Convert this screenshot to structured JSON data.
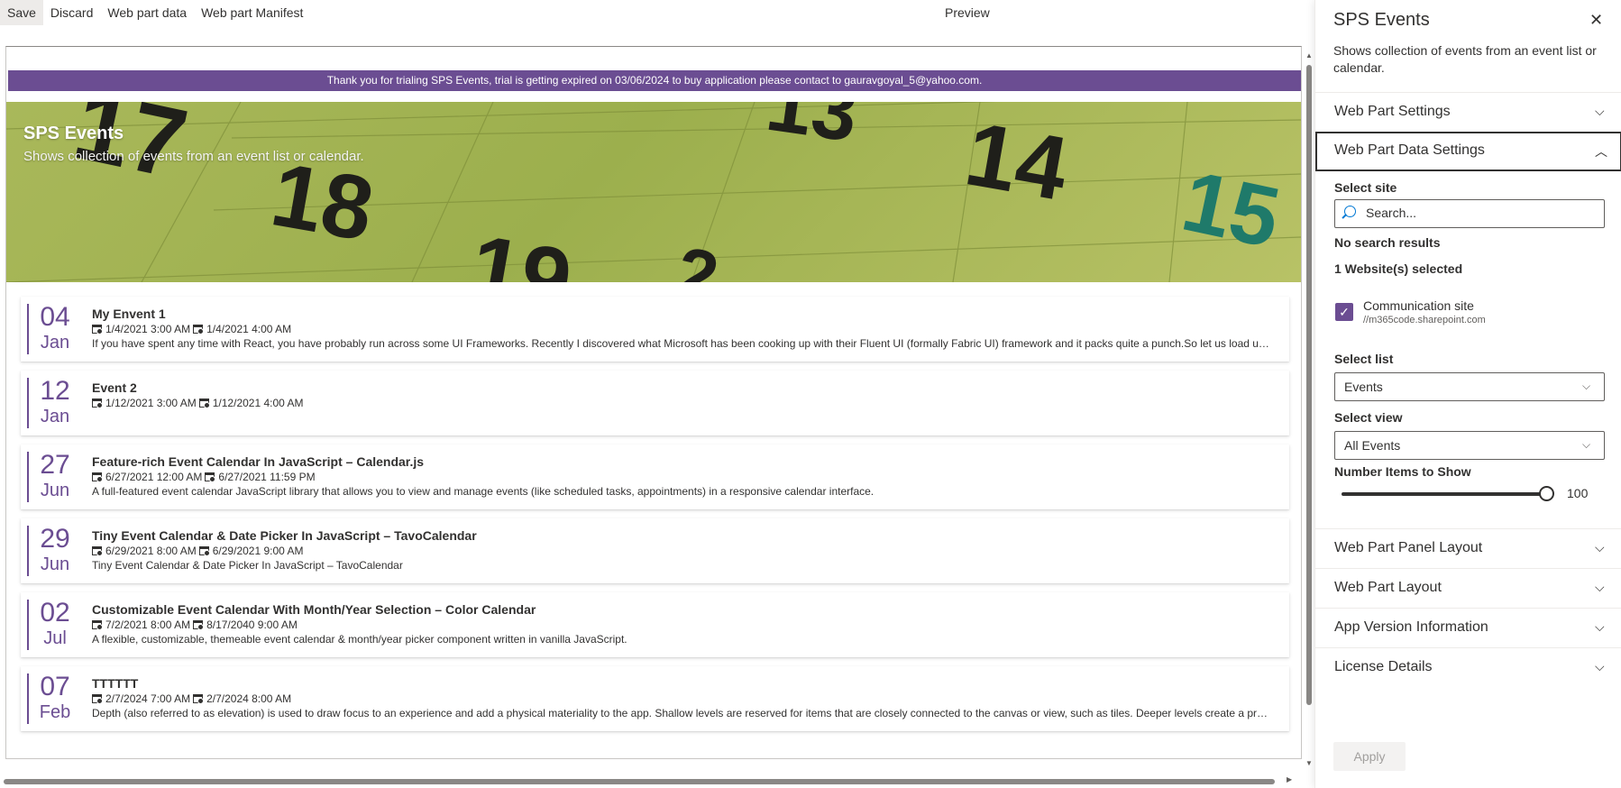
{
  "commandbar": {
    "save": "Save",
    "discard": "Discard",
    "webpart_data": "Web part data",
    "webpart_manifest": "Web part Manifest",
    "preview": "Preview"
  },
  "trial_banner": "Thank you for trialing SPS Events, trial is getting expired on 03/06/2024 to buy application please contact to gauravgoyal_5@yahoo.com.",
  "hero": {
    "title": "SPS Events",
    "subtitle": "Shows collection of events from an event list or calendar."
  },
  "events": [
    {
      "day": "04",
      "month": "Jan",
      "title": "My Envent 1",
      "start": "1/4/2021 3:00 AM",
      "end": "1/4/2021 4:00 AM",
      "description": "If you have spent any time with React, you have probably run across some UI Frameworks. Recently I discovered what Microsoft has been cooking up with their Fluent UI (formally Fabric UI) framework and it packs quite a punch.So let us load up a..."
    },
    {
      "day": "12",
      "month": "Jan",
      "title": "Event 2",
      "start": "1/12/2021 3:00 AM",
      "end": "1/12/2021 4:00 AM",
      "description": ""
    },
    {
      "day": "27",
      "month": "Jun",
      "title": "Feature-rich Event Calendar In JavaScript – Calendar.js",
      "start": "6/27/2021 12:00 AM",
      "end": "6/27/2021 11:59 PM",
      "description": "A full-featured event calendar JavaScript library that allows you to view and manage events (like scheduled tasks, appointments) in a responsive calendar interface."
    },
    {
      "day": "29",
      "month": "Jun",
      "title": "Tiny Event Calendar & Date Picker In JavaScript – TavoCalendar",
      "start": "6/29/2021 8:00 AM",
      "end": "6/29/2021 9:00 AM",
      "description": "Tiny Event Calendar & Date Picker In JavaScript – TavoCalendar"
    },
    {
      "day": "02",
      "month": "Jul",
      "title": "Customizable Event Calendar With Month/Year Selection – Color Calendar",
      "start": "7/2/2021 8:00 AM",
      "end": "8/17/2040 9:00 AM",
      "description": "A flexible, customizable, themeable event calendar & month/year picker component written in vanilla JavaScript."
    },
    {
      "day": "07",
      "month": "Feb",
      "title": "TTTTTT",
      "start": "2/7/2024 7:00 AM",
      "end": "2/7/2024 8:00 AM",
      "description": "Depth (also referred to as elevation) is used to draw focus to an experience and add a physical materiality to the app. Shallow levels are reserved for items that are closely connected to the canvas or view, such as tiles. Deeper levels create a prominent..."
    }
  ],
  "pane": {
    "title": "SPS Events",
    "description": "Shows collection of events from an event list or calendar.",
    "groups": {
      "webpart_settings": "Web Part Settings",
      "data_settings": "Web Part Data Settings",
      "panel_layout": "Web Part Panel Layout",
      "layout": "Web Part Layout",
      "version": "App Version Information",
      "license": "License Details"
    },
    "select_site_label": "Select site",
    "search_placeholder": "Search...",
    "no_results": "No search results",
    "selected_count": "1 Website(s) selected",
    "site_name": "Communication site",
    "site_url": "//m365code.sharepoint.com",
    "select_list_label": "Select list",
    "select_list_value": "Events",
    "select_view_label": "Select view",
    "select_view_value": "All Events",
    "items_label": "Number Items to Show",
    "items_value": "100",
    "apply": "Apply"
  },
  "colors": {
    "accent": "#6b4d92",
    "hero_green": "#a9b85a"
  }
}
